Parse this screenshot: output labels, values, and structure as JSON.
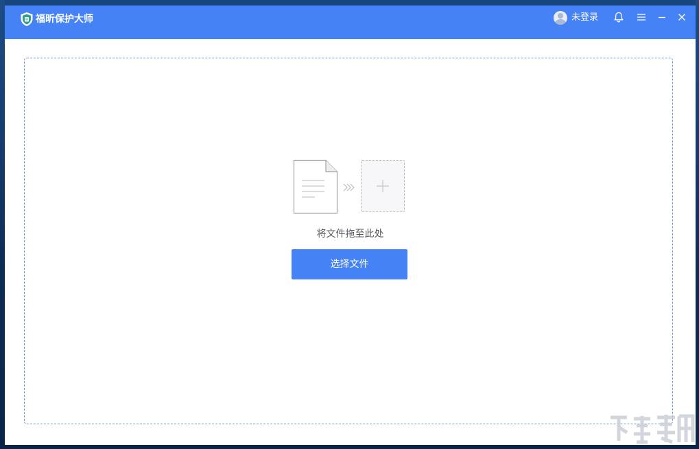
{
  "window": {
    "title": "福昕保护大师"
  },
  "header": {
    "user": {
      "login_label": "未登录",
      "avatar_icon": "user-avatar-icon"
    },
    "icons": [
      "shield-logo-icon",
      "bell-icon",
      "menu-icon",
      "minimize-icon",
      "close-icon"
    ]
  },
  "drop_zone": {
    "icons": [
      "document-icon",
      "double-chevron-right-icon",
      "plus-icon"
    ],
    "hint": "将文件拖至此处",
    "select_button_label": "选择文件"
  },
  "colors": {
    "accent": "#4582f5",
    "dashed_border": "#6b96d6",
    "hint_text": "#555a60"
  }
}
